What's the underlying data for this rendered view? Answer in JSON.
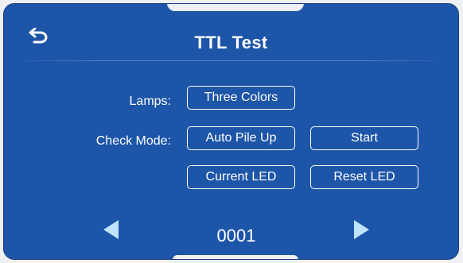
{
  "header": {
    "title": "TTL Test",
    "back_icon": "back-return-icon"
  },
  "lamps": {
    "label": "Lamps:",
    "value_button": "Three Colors"
  },
  "check_mode": {
    "label": "Check Mode:",
    "mode_button": "Auto Pile Up",
    "start_button": "Start"
  },
  "led": {
    "current_button": "Current LED",
    "reset_button": "Reset LED"
  },
  "pager": {
    "prev_icon": "triangle-left-icon",
    "value": "0001",
    "next_icon": "triangle-right-icon"
  },
  "colors": {
    "panel_bg": "#1d55a8",
    "arrow": "#bfe3fb",
    "text": "#ffffff"
  }
}
